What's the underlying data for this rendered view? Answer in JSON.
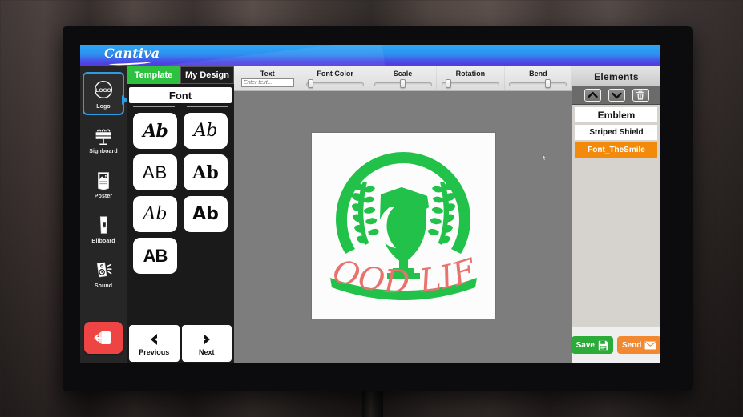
{
  "app": {
    "brand": "Cantiva"
  },
  "tabs": [
    {
      "label": "Template",
      "selected": true
    },
    {
      "label": "My Design",
      "selected": false
    }
  ],
  "sidebar": {
    "items": [
      {
        "label": "Logo",
        "icon": "logo-circle-icon",
        "active": true
      },
      {
        "label": "Signboard",
        "icon": "signboard-icon",
        "active": false
      },
      {
        "label": "Poster",
        "icon": "poster-icon",
        "active": false
      },
      {
        "label": "Bilboard",
        "icon": "billboard-icon",
        "active": false
      },
      {
        "label": "Sound",
        "icon": "speaker-icon",
        "active": false
      }
    ],
    "exit": {
      "label": "Exit",
      "icon": "exit-door-icon",
      "color": "#ef4444"
    }
  },
  "font_panel": {
    "title": "Font",
    "tiles": [
      {
        "sample": "Ab",
        "style": "ft1"
      },
      {
        "sample": "Ab",
        "style": "ft2"
      },
      {
        "sample": "AB",
        "style": "ft3"
      },
      {
        "sample": "Ab",
        "style": "ft4"
      },
      {
        "sample": "Ab",
        "style": "ft5"
      },
      {
        "sample": "Ab",
        "style": "ft6"
      },
      {
        "sample": "AB",
        "style": "ft7"
      }
    ],
    "previous_label": "Previous",
    "next_label": "Next"
  },
  "toolbar": {
    "text": {
      "label": "Text",
      "value": "",
      "placeholder": "Enter text..."
    },
    "font_color": {
      "label": "Font Color",
      "knob_pct": 3
    },
    "scale": {
      "label": "Scale",
      "knob_pct": 45
    },
    "rotation": {
      "label": "Rotation",
      "knob_pct": 7
    },
    "bend": {
      "label": "Bend",
      "knob_pct": 62
    }
  },
  "canvas": {
    "artwork_text": "GOOD LIFE",
    "emblem_color": "#22c24a",
    "text_color": "#e8736e",
    "background": "#fcfcfc",
    "stage_color": "#7d7d7d"
  },
  "elements_panel": {
    "title": "Elements",
    "tools": [
      {
        "name": "move-up",
        "icon": "chevron-up-icon"
      },
      {
        "name": "move-down",
        "icon": "chevron-down-icon"
      },
      {
        "name": "delete",
        "icon": "trash-icon"
      }
    ],
    "items": [
      {
        "label": "Emblem",
        "selected": false,
        "emphasis": true
      },
      {
        "label": "Striped Shield",
        "selected": false,
        "emphasis": false
      },
      {
        "label": "Font_TheSmile",
        "selected": true,
        "emphasis": false
      }
    ],
    "actions": [
      {
        "label": "Save",
        "icon": "floppy-icon",
        "color": "#2bab38"
      },
      {
        "label": "Send",
        "icon": "envelope-icon",
        "color": "#f2882f"
      }
    ]
  }
}
